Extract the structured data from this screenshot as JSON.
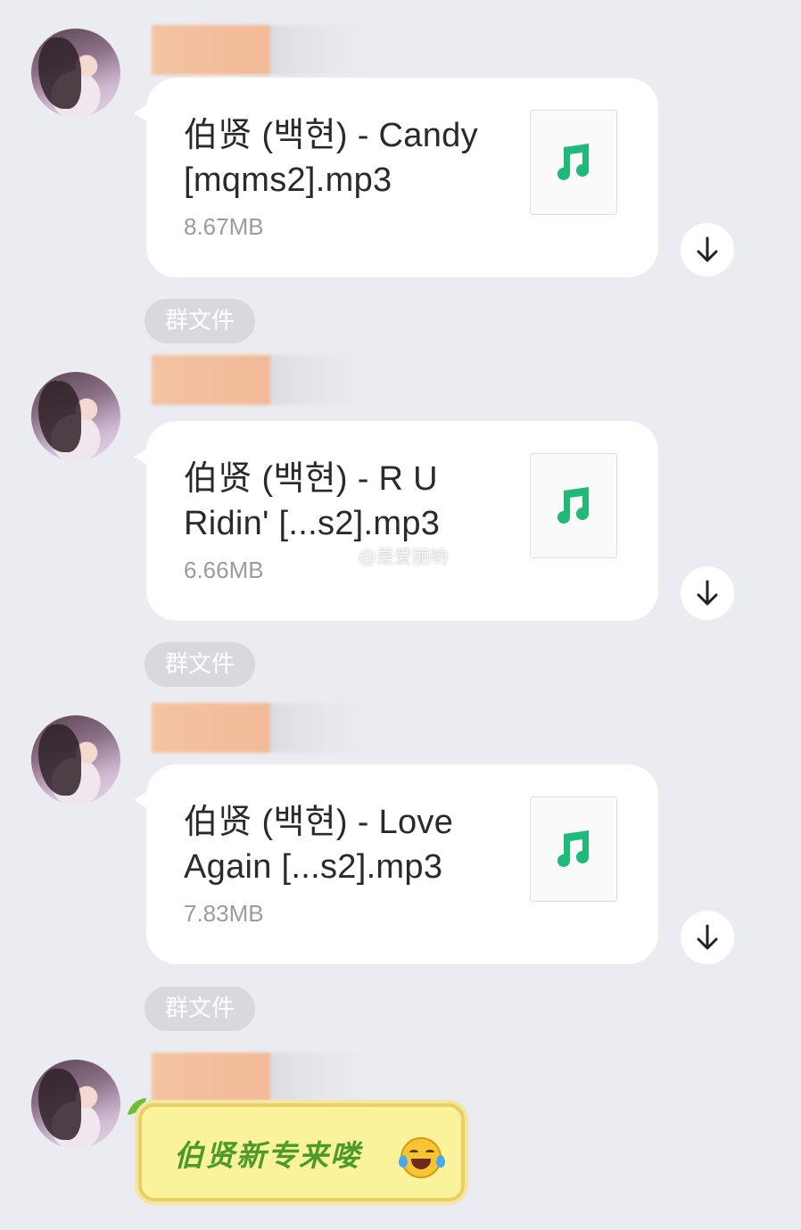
{
  "messages": [
    {
      "file": {
        "name": "伯贤 (백현) - Candy [mqms2].mp3",
        "size": "8.67MB",
        "icon": "music-note-icon"
      },
      "tag": "群文件"
    },
    {
      "file": {
        "name": "伯贤 (백현) - R U Ridin' [...s2].mp3",
        "size": "6.66MB",
        "icon": "music-note-icon"
      },
      "tag": "群文件"
    },
    {
      "file": {
        "name": "伯贤 (백현) - Love Again [...s2].mp3",
        "size": "7.83MB",
        "icon": "music-note-icon"
      },
      "tag": "群文件"
    }
  ],
  "sticker": {
    "text": "伯贤新专来喽",
    "emoji": "tears-of-joy-emoji"
  },
  "watermark": {
    "text": "@是爱丽哟",
    "icon": "weibo-icon"
  },
  "colors": {
    "background": "#ebecf1",
    "bubble": "#ffffff",
    "music_icon": "#1fb97a",
    "tag_bg": "#d8d9df",
    "sticker_bg": "#fbf29c",
    "sticker_text": "#4c9a2a"
  }
}
